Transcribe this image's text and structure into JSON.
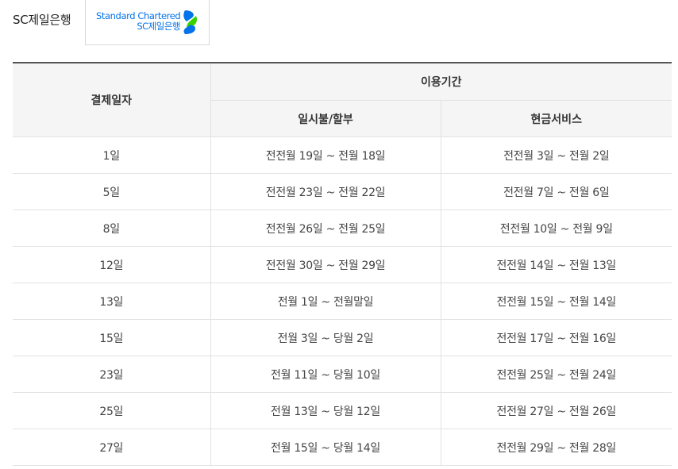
{
  "header": {
    "bank_name": "SC제일은행",
    "logo_en": "Standard Chartered",
    "logo_ko": "SC제일은행"
  },
  "table": {
    "col_payment_date": "결제일자",
    "col_period": "이용기간",
    "col_lumpsum": "일시불/할부",
    "col_cash": "현금서비스",
    "rows": [
      {
        "date": "1일",
        "lumpsum": "전전월 19일 ~ 전월 18일",
        "cash": "전전월 3일 ~ 전월 2일"
      },
      {
        "date": "5일",
        "lumpsum": "전전월 23일 ~ 전월 22일",
        "cash": "전전월 7일 ~ 전월 6일"
      },
      {
        "date": "8일",
        "lumpsum": "전전월 26일 ~ 전월 25일",
        "cash": "전전월 10일 ~ 전월 9일"
      },
      {
        "date": "12일",
        "lumpsum": "전전월 30일 ~ 전월 29일",
        "cash": "전전월 14일 ~ 전월 13일"
      },
      {
        "date": "13일",
        "lumpsum": "전월 1일 ~ 전월말일",
        "cash": "전전월 15일 ~ 전월 14일"
      },
      {
        "date": "15일",
        "lumpsum": "전월 3일 ~ 당월 2일",
        "cash": "전전월 17일 ~ 전월 16일"
      },
      {
        "date": "23일",
        "lumpsum": "전월 11일 ~ 당월 10일",
        "cash": "전전월 25일 ~ 전월 24일"
      },
      {
        "date": "25일",
        "lumpsum": "전월 13일 ~ 당월 12일",
        "cash": "전전월 27일 ~ 전월 26일"
      },
      {
        "date": "27일",
        "lumpsum": "전월 15일 ~ 당월 14일",
        "cash": "전전월 29일 ~ 전월 28일"
      }
    ]
  },
  "colors": {
    "brand_blue": "#0473ea",
    "brand_green": "#38d200",
    "header_bg": "#f5f5f5"
  },
  "icons": {
    "logo_mark": "standard-chartered-logo-icon"
  }
}
